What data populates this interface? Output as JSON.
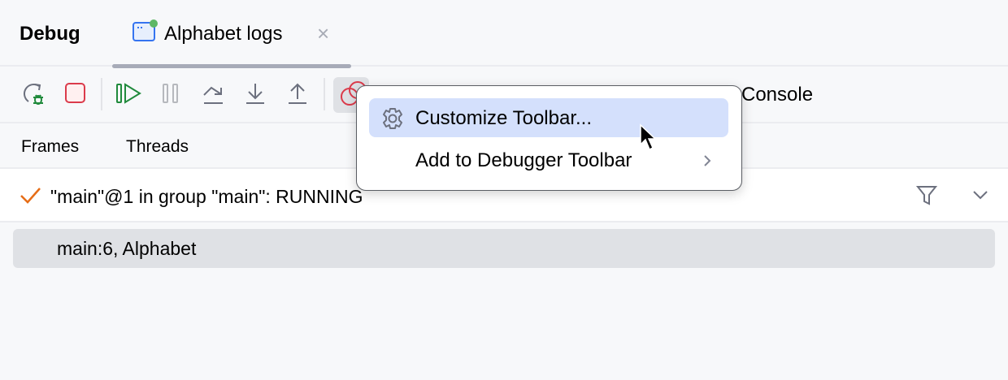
{
  "header": {
    "title": "Debug",
    "tab_label": "Alphabet logs",
    "close": "×"
  },
  "toolbar": {
    "console_label": "Console"
  },
  "subtabs": [
    {
      "label": "Frames",
      "active": true
    },
    {
      "label": "Threads",
      "active": false
    }
  ],
  "thread": {
    "text": "\"main\"@1 in group \"main\": RUNNING"
  },
  "frames": [
    {
      "text": "main:6, Alphabet"
    }
  ],
  "menu": {
    "items": [
      {
        "label": "Customize Toolbar...",
        "selected": true
      },
      {
        "label": "Add to Debugger Toolbar",
        "submenu": true
      }
    ]
  },
  "colors": {
    "accent": "#3574f0",
    "selection": "#d4e0fc",
    "running": "#e66d17",
    "stop": "#db3b4b",
    "resume": "#208a3c"
  }
}
